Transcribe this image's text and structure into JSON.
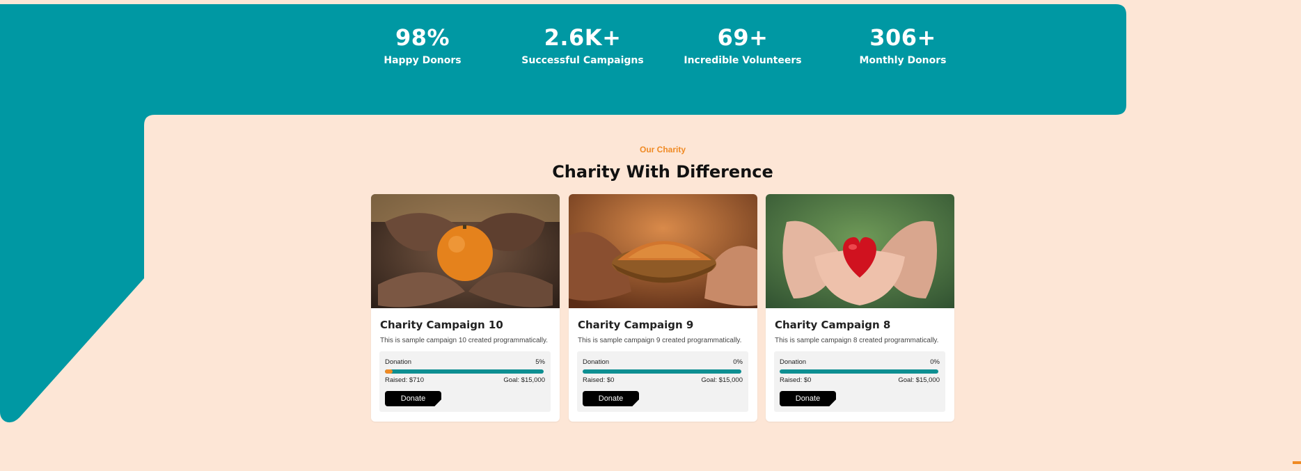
{
  "stats": [
    {
      "value": "98%",
      "label": "Happy Donors"
    },
    {
      "value": "2.6K+",
      "label": "Successful Campaigns"
    },
    {
      "value": "69+",
      "label": "Incredible Volunteers"
    },
    {
      "value": "306+",
      "label": "Monthly Donors"
    }
  ],
  "section": {
    "eyebrow": "Our Charity",
    "heading": "Charity With Difference"
  },
  "campaigns": [
    {
      "title": "Charity Campaign 10",
      "description": "This is sample campaign 10 created programmatically.",
      "donation_label": "Donation",
      "percent_text": "5%",
      "percent": 5,
      "raised": "Raised: $710",
      "goal": "Goal: $15,000",
      "button": "Donate",
      "image": "hands-holding-orange"
    },
    {
      "title": "Charity Campaign 9",
      "description": "This is sample campaign 9 created programmatically.",
      "donation_label": "Donation",
      "percent_text": "0%",
      "percent": 0,
      "raised": "Raised: $0",
      "goal": "Goal: $15,000",
      "button": "Donate",
      "image": "hands-giving-bowl-of-food"
    },
    {
      "title": "Charity Campaign 8",
      "description": "This is sample campaign 8 created programmatically.",
      "donation_label": "Donation",
      "percent_text": "0%",
      "percent": 0,
      "raised": "Raised: $0",
      "goal": "Goal: $15,000",
      "button": "Donate",
      "image": "hands-holding-red-heart"
    }
  ],
  "colors": {
    "teal": "#0098a3",
    "background": "#fde6d6",
    "accent": "#f08a24",
    "bar": "#0e8f92"
  }
}
